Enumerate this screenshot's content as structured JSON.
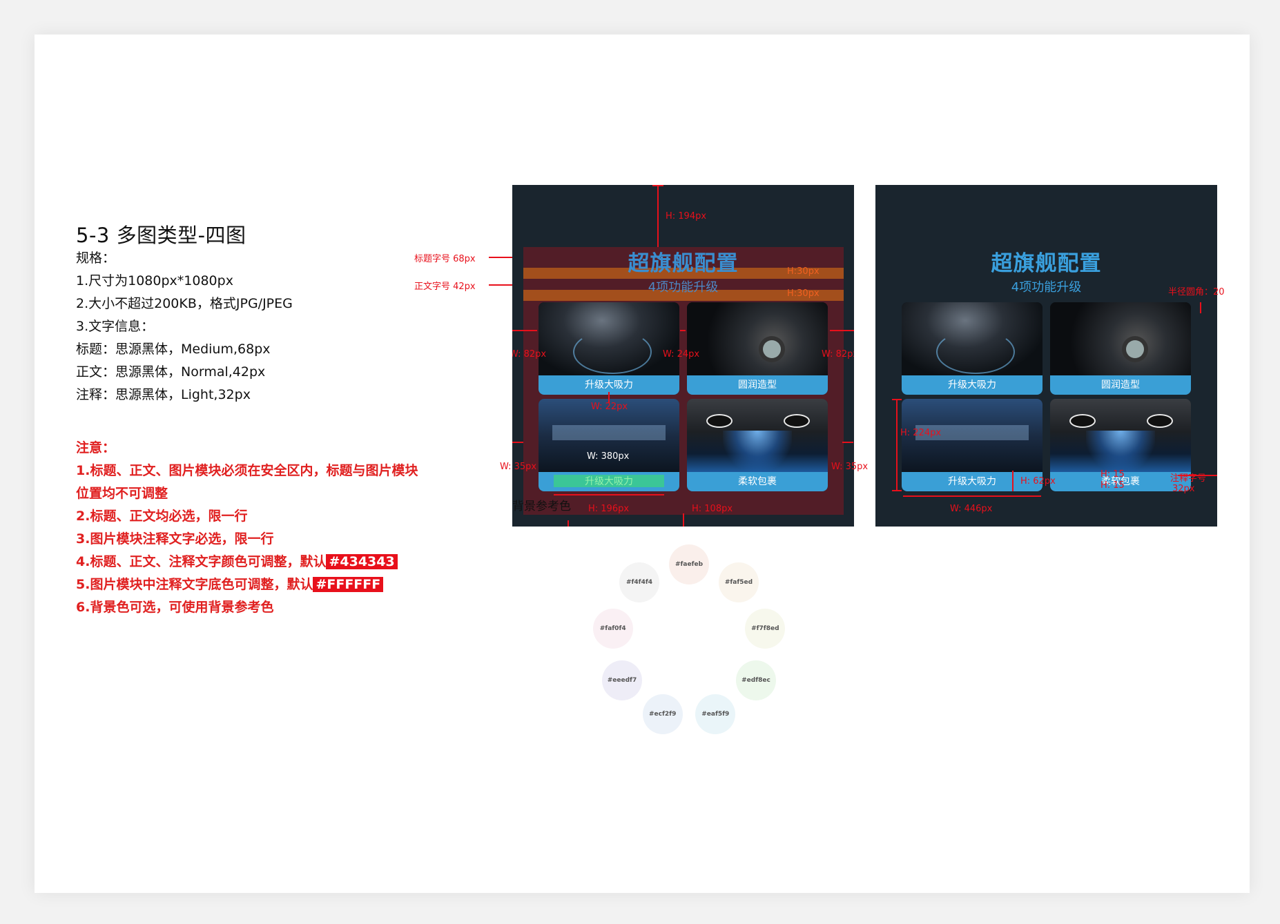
{
  "section_title": "5-3 多图类型-四图",
  "spec": {
    "heading": "规格：",
    "lines": [
      "1.尺寸为1080px*1080px",
      "2.大小不超过200KB，格式JPG/JPEG",
      "3.文字信息：",
      "标题：思源黑体，Medium,68px",
      "正文：思源黑体，Normal,42px",
      "注释：思源黑体，Light,32px"
    ]
  },
  "notes": {
    "heading": "注意：",
    "line1a": "1.标题、正文、图片模块必须在安全区内，标题与图片模块",
    "line1b": "位置均不可调整",
    "line2": "2.标题、正文均必选，限一行",
    "line3": "3.图片模块注释文字必选，限一行",
    "line4": "4.标题、正文、注释文字颜色可调整，默认",
    "line4_color": "#434343",
    "line5": "5.图片模块中注释文字底色可调整，默认",
    "line5_color": "#FFFFFF",
    "line6": "6.背景色可选，可使用背景参考色"
  },
  "poster": {
    "title": "超旗舰配置",
    "subtitle": "4项功能升级",
    "captions": [
      "升级大吸力",
      "圆润造型",
      "升级大吸力",
      "柔软包裹"
    ]
  },
  "annotations_left": {
    "title_size": "标题字号 68px",
    "body_size": "正文字号 42px",
    "h194": "H: 194px",
    "h30a": "H:30px",
    "h30b": "H:30px",
    "w82a": "W: 82px",
    "w24": "W: 24px",
    "w82b": "W: 82px",
    "w22": "W: 22px",
    "w380": "W: 380px",
    "w35a": "W: 35px",
    "w35b": "W: 35px",
    "h196": "H: 196px",
    "h108": "H: 108px"
  },
  "annotations_right": {
    "radius": "半径圆角：20",
    "h224": "H: 224px",
    "h62": "H: 62px",
    "h15a": "H: 15",
    "h15b": "H: 15",
    "note_size_a": "注释字号",
    "note_size_b": "32px",
    "w446": "W: 446px"
  },
  "bg_reference": {
    "label": "背景参考色",
    "colors": [
      "#faefeb",
      "#faf5ed",
      "#f7f8ed",
      "#edf8ec",
      "#eaf5f9",
      "#ecf2f9",
      "#eeedf7",
      "#faf0f4",
      "#f4f4f4"
    ]
  }
}
